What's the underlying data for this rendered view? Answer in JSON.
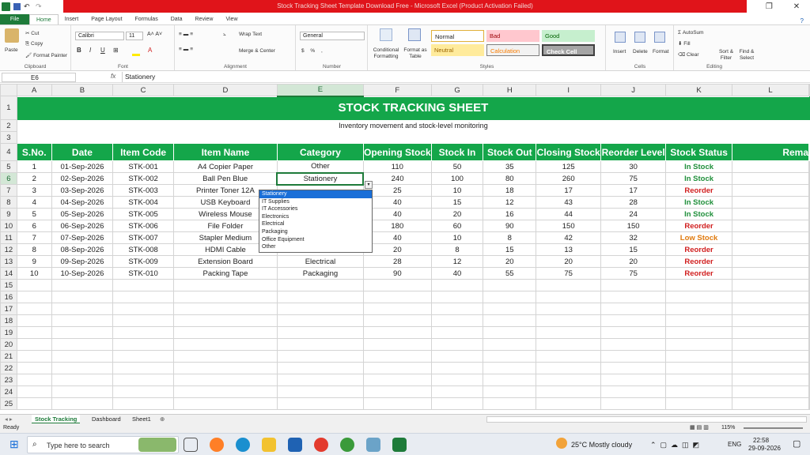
{
  "window": {
    "title": "Stock Tracking Sheet Template Download Free  -  Microsoft Excel (Product Activation Failed)"
  },
  "tabs": [
    "File",
    "Home",
    "Insert",
    "Page Layout",
    "Formulas",
    "Data",
    "Review",
    "View"
  ],
  "ribbon": {
    "clipboard": {
      "paste": "Paste",
      "cut": "Cut",
      "copy": "Copy",
      "format_painter": "Format Painter",
      "label": "Clipboard"
    },
    "font": {
      "name": "Calibri",
      "size": "11",
      "label": "Font"
    },
    "alignment": {
      "wrap": "Wrap Text",
      "merge": "Merge & Center",
      "label": "Alignment"
    },
    "number": {
      "format": "General",
      "label": "Number"
    },
    "styles": {
      "cond": "Conditional Formatting",
      "table": "Format as Table",
      "normal": "Normal",
      "bad": "Bad",
      "good": "Good",
      "neutral": "Neutral",
      "calculation": "Calculation",
      "check": "Check Cell",
      "label": "Styles"
    },
    "cells": {
      "insert": "Insert",
      "delete": "Delete",
      "format": "Format",
      "label": "Cells"
    },
    "editing": {
      "autosum": "AutoSum",
      "fill": "Fill",
      "clear": "Clear",
      "sort": "Sort & Filter",
      "find": "Find & Select",
      "label": "Editing"
    }
  },
  "formula_bar": {
    "name_box": "E6",
    "fx": "fx",
    "value": "Stationery"
  },
  "columns": [
    "A",
    "B",
    "C",
    "D",
    "E",
    "F",
    "G",
    "H",
    "I",
    "J",
    "K",
    "L"
  ],
  "sheet": {
    "title": "STOCK TRACKING SHEET",
    "subtitle": "Inventory movement and stock-level monitoring",
    "headers": [
      "S.No.",
      "Date",
      "Item Code",
      "Item Name",
      "Category",
      "Opening Stock",
      "Stock In",
      "Stock Out",
      "Closing Stock",
      "Reorder Level",
      "Stock Status",
      "Rema"
    ],
    "rows": [
      [
        "1",
        "01-Sep-2026",
        "STK-001",
        "A4 Copier Paper",
        "Other",
        "110",
        "50",
        "35",
        "125",
        "30",
        "In Stock"
      ],
      [
        "2",
        "02-Sep-2026",
        "STK-002",
        "Ball Pen Blue",
        "Stationery",
        "240",
        "100",
        "80",
        "260",
        "75",
        "In Stock"
      ],
      [
        "3",
        "03-Sep-2026",
        "STK-003",
        "Printer Toner 12A",
        "",
        "25",
        "10",
        "18",
        "17",
        "17",
        "Reorder"
      ],
      [
        "4",
        "04-Sep-2026",
        "STK-004",
        "USB Keyboard",
        "",
        "40",
        "15",
        "12",
        "43",
        "28",
        "In Stock"
      ],
      [
        "5",
        "05-Sep-2026",
        "STK-005",
        "Wireless Mouse",
        "",
        "40",
        "20",
        "16",
        "44",
        "24",
        "In Stock"
      ],
      [
        "6",
        "06-Sep-2026",
        "STK-006",
        "File Folder",
        "",
        "180",
        "60",
        "90",
        "150",
        "150",
        "Reorder"
      ],
      [
        "7",
        "07-Sep-2026",
        "STK-007",
        "Stapler Medium",
        "",
        "40",
        "10",
        "8",
        "42",
        "32",
        "Low Stock"
      ],
      [
        "8",
        "08-Sep-2026",
        "STK-008",
        "HDMI Cable",
        "Electronics",
        "20",
        "8",
        "15",
        "13",
        "15",
        "Reorder"
      ],
      [
        "9",
        "09-Sep-2026",
        "STK-009",
        "Extension Board",
        "Electrical",
        "28",
        "12",
        "20",
        "20",
        "20",
        "Reorder"
      ],
      [
        "10",
        "10-Sep-2026",
        "STK-010",
        "Packing Tape",
        "Packaging",
        "90",
        "40",
        "55",
        "75",
        "75",
        "Reorder"
      ]
    ],
    "status_colors": {
      "In Stock": "#1f8f3a",
      "Reorder": "#d11f1f",
      "Low Stock": "#e07a0e"
    }
  },
  "dropdown": {
    "items": [
      "Stationery",
      "IT Supplies",
      "IT Accessories",
      "Electronics",
      "Electrical",
      "Packaging",
      "Office Equipment",
      "Other"
    ],
    "selected": "Stationery"
  },
  "sheet_tabs": [
    "Stock Tracking",
    "Dashboard",
    "Sheet1"
  ],
  "status": {
    "ready": "Ready",
    "zoom": "115%"
  },
  "taskbar": {
    "search": "Type here to search",
    "weather": "25°C  Mostly cloudy",
    "lang": "ENG",
    "time": "22:58",
    "date": "29-09-2026"
  }
}
